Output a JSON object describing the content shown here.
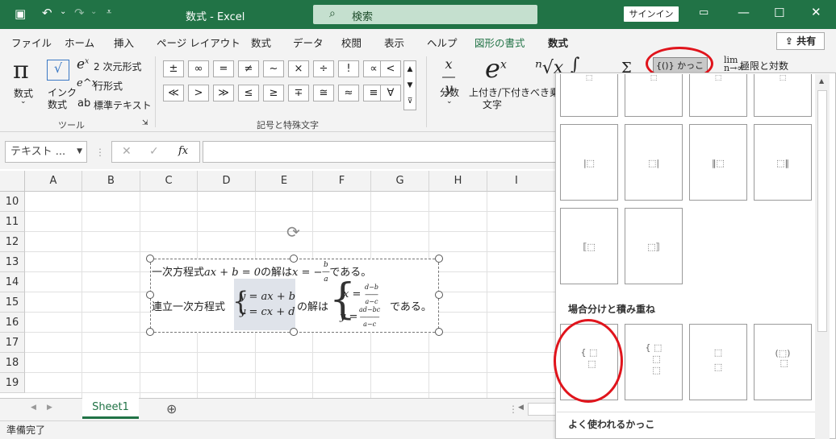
{
  "titlebar": {
    "title": "数式  -  Excel",
    "search": "検索",
    "signin": "サインイン"
  },
  "tabs": [
    "ファイル",
    "ホーム",
    "挿入",
    "ページ レイアウト",
    "数式",
    "データ",
    "校閲",
    "表示",
    "ヘルプ",
    "図形の書式",
    "数式"
  ],
  "share": "共有",
  "ribbon": {
    "equation": "数式",
    "ink_eq_1": "インク",
    "ink_eq_2": "数式",
    "binomial": "2 次元形式",
    "linear": "行形式",
    "plain_text": "標準テキスト",
    "tools_label": "ツール",
    "symbols_label": "記号と特殊文字",
    "symbols": [
      "±",
      "∞",
      "=",
      "≠",
      "~",
      "×",
      "÷",
      "!",
      "∝",
      "<",
      "≪",
      ">",
      "≫",
      "≤",
      "≥",
      "∓",
      "≅",
      "≈",
      "≡",
      "∀"
    ],
    "fraction": "分数",
    "script_1": "上付き/下付き",
    "script_2": "文字",
    "radical": "べき乗",
    "bracket": "かっこ",
    "limit": "極限と対数"
  },
  "formula_bar": {
    "namebox": "テキスト ...",
    "fx": "fx"
  },
  "columns": [
    "A",
    "B",
    "C",
    "D",
    "E",
    "F",
    "G",
    "H",
    "I"
  ],
  "rows": [
    "10",
    "11",
    "12",
    "13",
    "14",
    "15",
    "16",
    "17",
    "18",
    "19"
  ],
  "equation_text": {
    "line1_pre": "一次方程式",
    "line1_math": "ax + b = 0",
    "line1_mid": "の解は",
    "line1_sol": "x = −",
    "line1_post": "である。",
    "line2_pre": "連立一次方程式",
    "sys1": "y = ax + b",
    "sys2": "y = cx + d",
    "line2_mid": "の解は",
    "sol_x": "x =",
    "sol_y": "y =",
    "line2_post": "である。"
  },
  "panel": {
    "section1": "場合分けと積み重ね",
    "section2": "よく使われるかっこ"
  },
  "sheet": {
    "tab": "Sheet1"
  },
  "status": "準備完了"
}
